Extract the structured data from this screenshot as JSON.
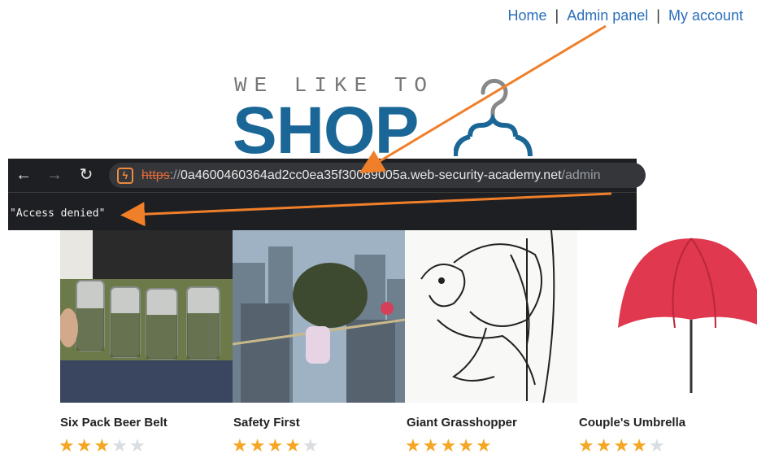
{
  "nav": {
    "home": "Home",
    "separator": "|",
    "admin_panel": "Admin panel",
    "my_account": "My account"
  },
  "logo": {
    "tagline": "WE LIKE TO",
    "word": "SHOP"
  },
  "browser": {
    "back_icon": "back-arrow-icon",
    "forward_icon": "forward-arrow-icon",
    "reload_icon": "reload-icon",
    "site_icon": "lightning-icon",
    "url_scheme": "https",
    "url_separator": "://",
    "url_host": "0a4600460364ad2cc0ea35f30089005a.web-security-academy.net",
    "url_path": "/admin",
    "response_body": "\"Access denied\""
  },
  "products": [
    {
      "name": "Six Pack Beer Belt",
      "rating": 3,
      "max_rating": 5
    },
    {
      "name": "Safety First",
      "rating": 4,
      "max_rating": 5
    },
    {
      "name": "Giant Grasshopper",
      "rating": 5,
      "max_rating": 5
    },
    {
      "name": "Couple's Umbrella",
      "rating": 4,
      "max_rating": 5
    }
  ],
  "colors": {
    "link": "#2a6ebb",
    "brand": "#1a6696",
    "arrow": "#f07f2a",
    "star": "#f5a623",
    "star_empty": "#d8dde2",
    "browser_bg": "#1e1f22"
  }
}
